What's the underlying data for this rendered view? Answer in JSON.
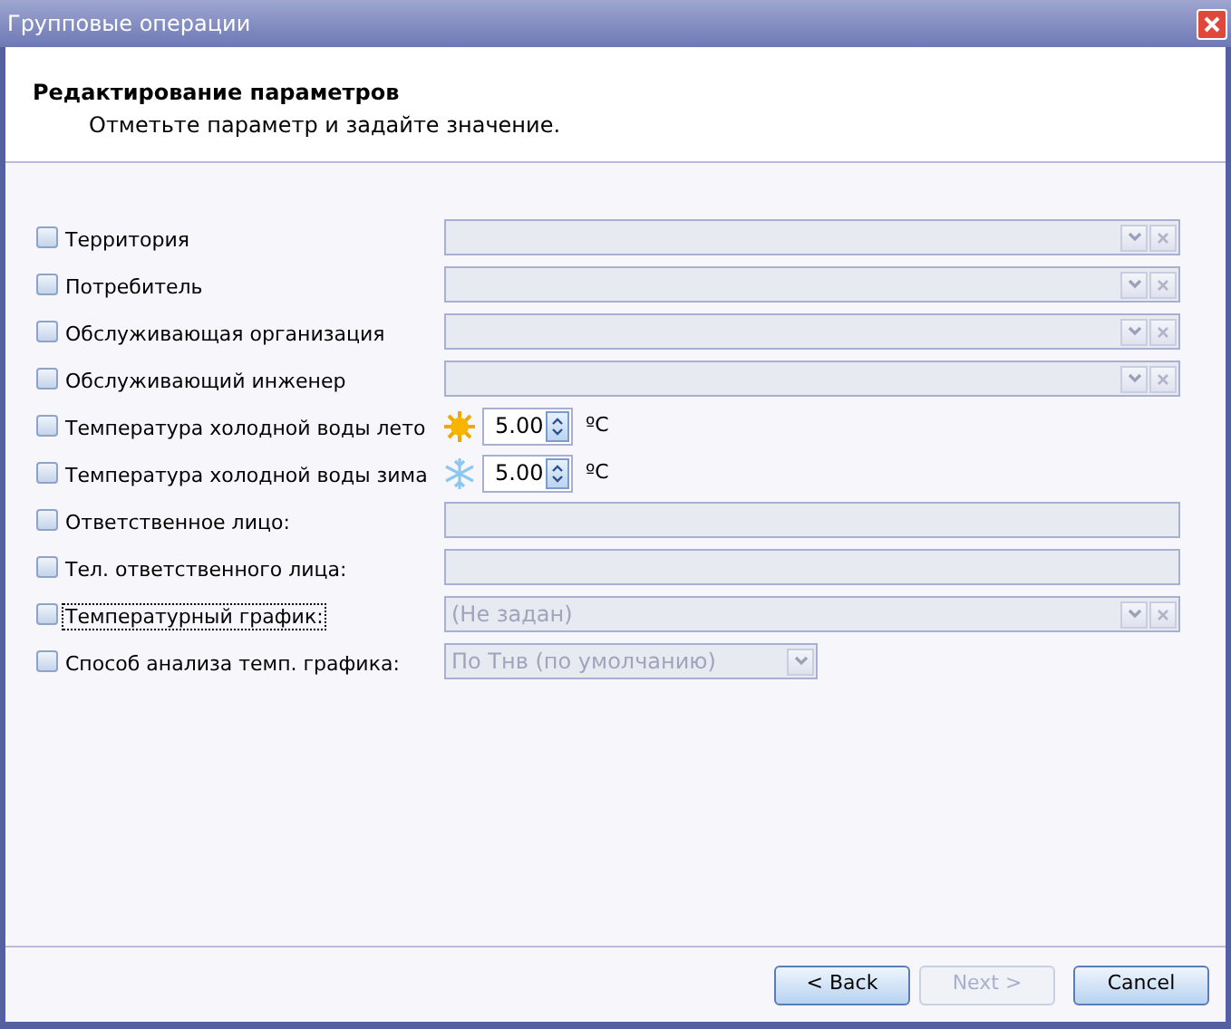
{
  "window": {
    "title": "Групповые операции"
  },
  "header": {
    "title": "Редактирование параметров",
    "subtitle": "Отметьте параметр и задайте значение."
  },
  "rows": [
    {
      "kind": "combo",
      "label": "Территория",
      "checked": false,
      "focused": false
    },
    {
      "kind": "combo",
      "label": "Потребитель",
      "checked": false,
      "focused": false
    },
    {
      "kind": "combo",
      "label": "Обслуживающая организация",
      "checked": false,
      "focused": false
    },
    {
      "kind": "combo",
      "label": "Обслуживающий инженер",
      "checked": false,
      "focused": false
    },
    {
      "kind": "summer_spin",
      "label": "Температура холодной воды лето",
      "checked": false,
      "focused": false,
      "value": "5.00",
      "unit": "ºC"
    },
    {
      "kind": "winter_spin",
      "label": "Температура холодной воды зима",
      "checked": false,
      "focused": false,
      "value": "5.00",
      "unit": "ºC"
    },
    {
      "kind": "text",
      "label": "Ответственное лицо:",
      "checked": false,
      "focused": false
    },
    {
      "kind": "text",
      "label": "Тел. ответственного лица:",
      "checked": false,
      "focused": false
    },
    {
      "kind": "combo",
      "label": "Температурный график:",
      "checked": false,
      "focused": true,
      "value": "(Не задан)"
    },
    {
      "kind": "short_combo",
      "label": "Способ анализа темп. графика:",
      "checked": false,
      "focused": false,
      "value": "По Тнв (по умолчанию)"
    }
  ],
  "buttons": [
    {
      "label": "< Back",
      "disabled": false
    },
    {
      "label": "Next >",
      "disabled": true
    },
    {
      "label": "Cancel",
      "disabled": false
    }
  ]
}
